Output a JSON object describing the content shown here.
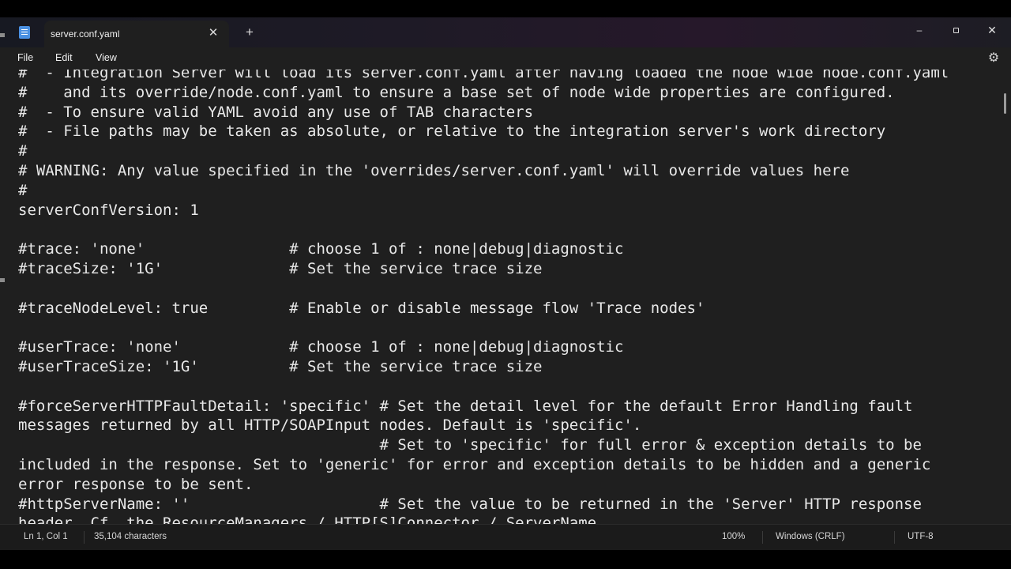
{
  "tab": {
    "title": "server.conf.yaml",
    "close_glyph": "✕",
    "new_glyph": "+"
  },
  "window_controls": {
    "minimize": "–",
    "close": "✕"
  },
  "menu": {
    "file": "File",
    "edit": "Edit",
    "view": "View"
  },
  "editor": {
    "lines": [
      "#  - Integration Server will load its server.conf.yaml after having loaded the node wide node.conf.yaml",
      "#    and its override/node.conf.yaml to ensure a base set of node wide properties are configured.",
      "#  - To ensure valid YAML avoid any use of TAB characters",
      "#  - File paths may be taken as absolute, or relative to the integration server's work directory",
      "#",
      "# WARNING: Any value specified in the 'overrides/server.conf.yaml' will override values here",
      "#",
      "serverConfVersion: 1",
      "",
      "#trace: 'none'                # choose 1 of : none|debug|diagnostic",
      "#traceSize: '1G'              # Set the service trace size",
      "",
      "#traceNodeLevel: true         # Enable or disable message flow 'Trace nodes'",
      "",
      "#userTrace: 'none'            # choose 1 of : none|debug|diagnostic",
      "#userTraceSize: '1G'          # Set the service trace size",
      "",
      "#forceServerHTTPFaultDetail: 'specific' # Set the detail level for the default Error Handling fault",
      "messages returned by all HTTP/SOAPInput nodes. Default is 'specific'.",
      "                                        # Set to 'specific' for full error & exception details to be",
      "included in the response. Set to 'generic' for error and exception details to be hidden and a generic",
      "error response to be sent.",
      "#httpServerName: ''                     # Set the value to be returned in the 'Server' HTTP response",
      "header. Cf. the ResourceManagers / HTTP[S]Connector / ServerName"
    ]
  },
  "status": {
    "position": "Ln 1, Col 1",
    "characters": "35,104 characters",
    "zoom": "100%",
    "line_ending": "Windows (CRLF)",
    "encoding": "UTF-8"
  },
  "icons": {
    "app": "notepad-icon",
    "settings": "gear-icon"
  }
}
